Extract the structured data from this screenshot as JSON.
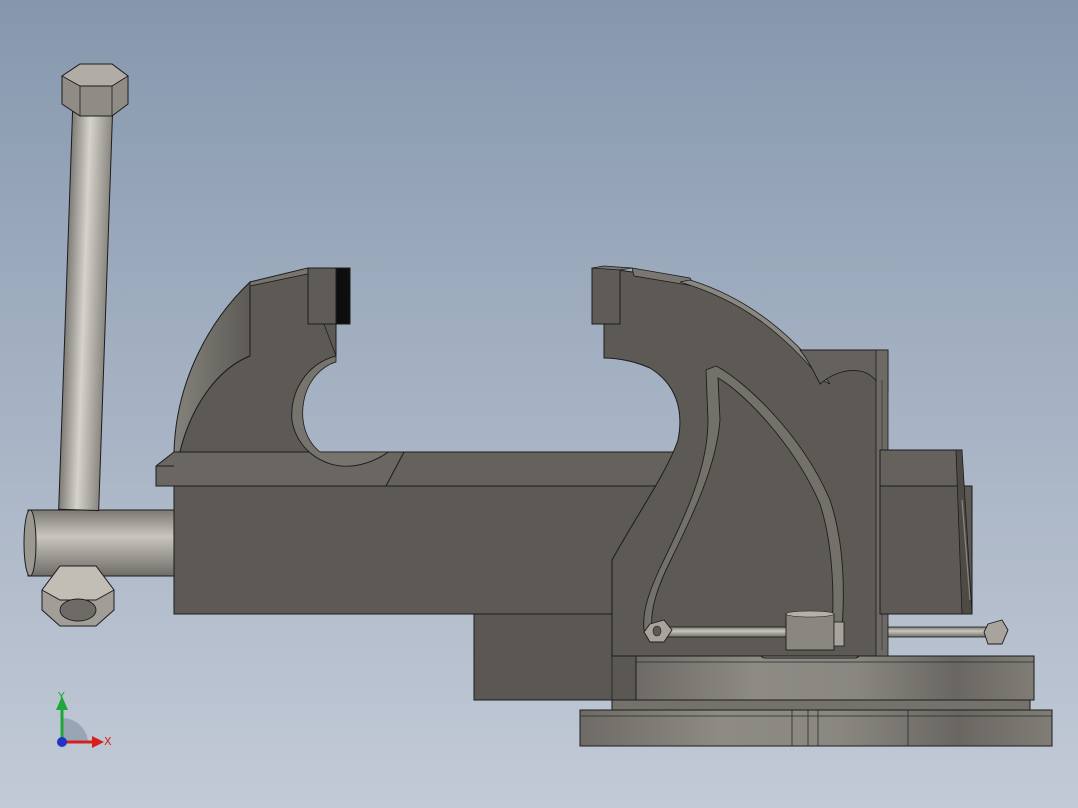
{
  "viewport": {
    "background_top": "#8697ad",
    "background_bottom": "#c2cad6"
  },
  "model": {
    "body_color": "#5d5a55",
    "body_light": "#6b6862",
    "body_dark": "#4a4743",
    "metal_color": "#b5b1aa",
    "jaw_pad_color": "#111111",
    "edge_color": "#1c1c1c"
  },
  "triad": {
    "y_label": "Y",
    "x_label": "X",
    "y_color": "#1fa83a",
    "x_color": "#d62020",
    "z_color": "#2233c8"
  }
}
